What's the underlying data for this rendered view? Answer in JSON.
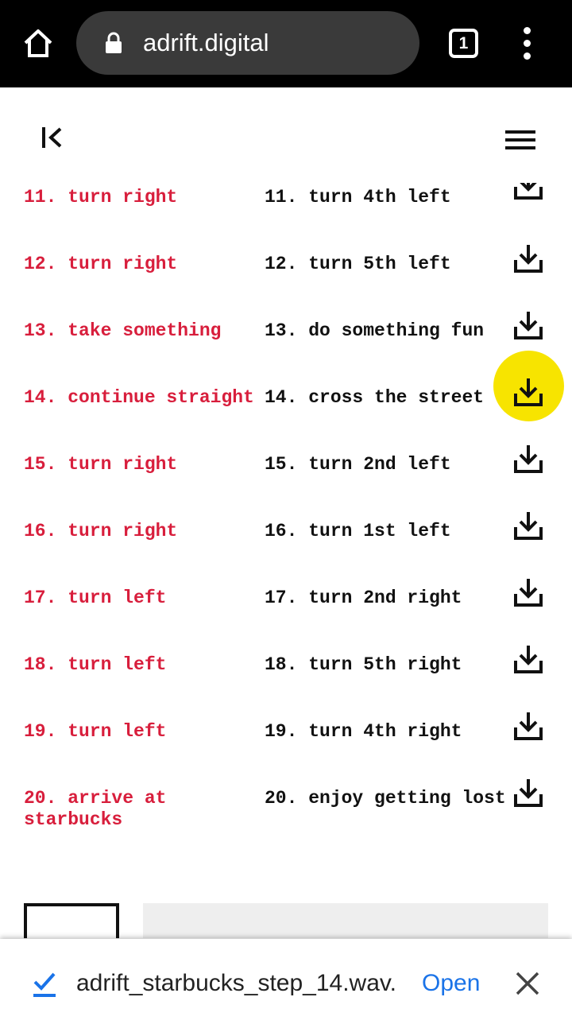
{
  "browser": {
    "url": "adrift.digital",
    "tab_count": "1"
  },
  "rows": [
    {
      "left": "11. turn right",
      "right": "11. turn 4th left",
      "download_icon": "download-icon"
    },
    {
      "left": "12. turn right",
      "right": "12. turn 5th left",
      "download_icon": "download-icon"
    },
    {
      "left": "13. take something",
      "right": "13. do something fun",
      "download_icon": "download-icon"
    },
    {
      "left": "14. continue straight",
      "right": "14. cross the street",
      "download_icon": "download-icon",
      "highlighted": true
    },
    {
      "left": "15. turn right",
      "right": "15. turn 2nd left",
      "download_icon": "download-icon"
    },
    {
      "left": "16. turn right",
      "right": "16. turn 1st left",
      "download_icon": "download-icon"
    },
    {
      "left": "17. turn left",
      "right": "17. turn 2nd right",
      "download_icon": "download-icon"
    },
    {
      "left": "18. turn left",
      "right": "18. turn 5th right",
      "download_icon": "download-icon"
    },
    {
      "left": "19. turn left",
      "right": "19. turn 4th right",
      "download_icon": "download-icon"
    },
    {
      "left": "20. arrive at starbucks",
      "right": "20. enjoy getting lost",
      "download_icon": "download-icon"
    }
  ],
  "colors": {
    "left_text": "#d81e3c",
    "right_text": "#111111",
    "highlight": "#f7e400",
    "link": "#1a73e8"
  },
  "snackbar": {
    "filename": "adrift_starbucks_step_14.wav.",
    "open_label": "Open"
  }
}
